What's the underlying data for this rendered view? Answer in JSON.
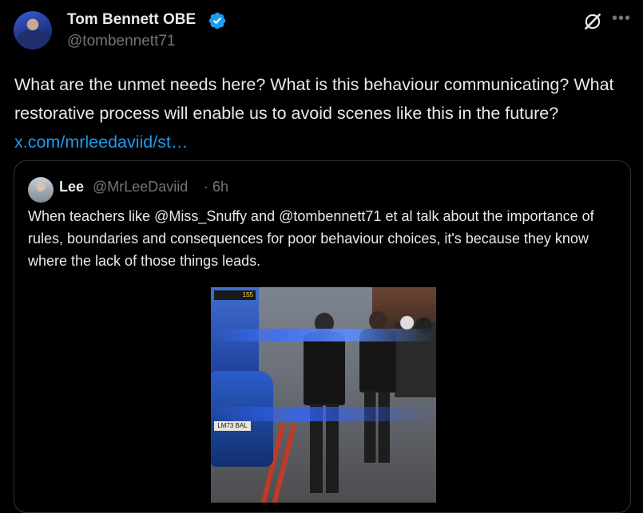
{
  "author": {
    "display_name": "Tom Bennett OBE",
    "handle": "@tombennett71"
  },
  "tweet": {
    "text": "What are the unmet needs here? What is this behaviour communicating? What restorative process will enable us to avoid scenes like this in the future? ",
    "link": "x.com/mrleedaviid/st…"
  },
  "quote": {
    "name": "Lee",
    "handle": "@MrLeeDaviid",
    "separator": "·",
    "time": "6h",
    "text": "When teachers like @Miss_Snuffy and @tombennett71 et al talk about the importance of rules, boundaries and consequences for poor behaviour choices, it's  because they know where the lack of those things leads.",
    "media": {
      "bus_sign": "155",
      "plate": "LM73 BAL"
    }
  },
  "icons": {
    "verified": "verified-badge-icon",
    "grok": "grok-icon",
    "more": "more-icon"
  },
  "colors": {
    "background": "#000000",
    "text": "#e7e9ea",
    "secondary": "#71767b",
    "link": "#1d9bf0",
    "border": "#2f3336"
  }
}
